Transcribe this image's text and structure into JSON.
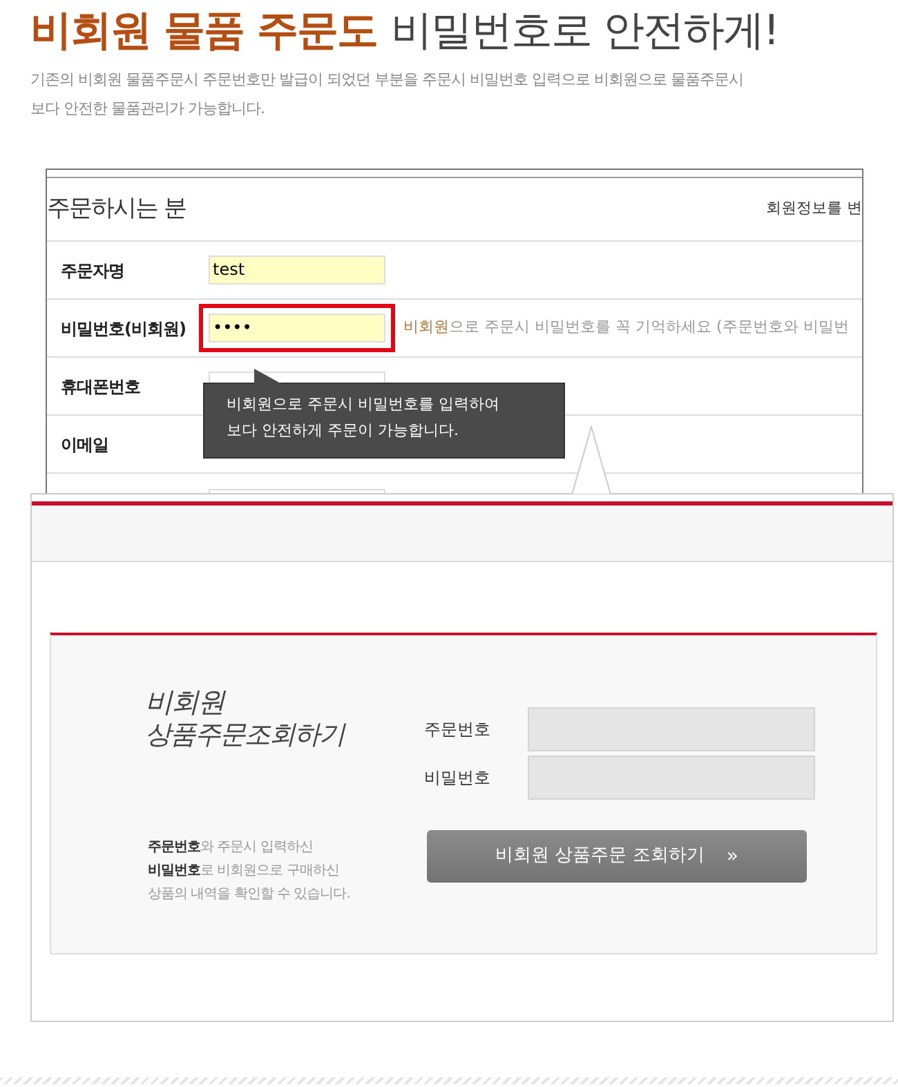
{
  "headline": {
    "accent": "비회원 물품 주문도",
    "rest": "비밀번호로 안전하게!"
  },
  "intro": [
    "기존의 비회원 물품주문시 주문번호만 발급이 되었던 부분을 주문시 비밀번호 입력으로 비회원으로 물품주문시",
    "보다 안전한 물품관리가 가능합니다."
  ],
  "order_form": {
    "title": "주문하시는 분",
    "top_link": "회원정보를 변",
    "rows": [
      {
        "label": "주문자명",
        "value": "test",
        "highlighted": false,
        "field_shown": true
      },
      {
        "label": "비밀번호(비회원)",
        "value": "••••",
        "highlighted": true,
        "field_shown": true,
        "hint_accent": "비회원",
        "hint": "으로 주문시 비밀번호를 꼭 기억하세요 (주문번호와 비밀번"
      },
      {
        "label": "휴대폰번호",
        "value": "",
        "highlighted": false,
        "field_shown": true
      },
      {
        "label": "이메일",
        "value": "",
        "highlighted": false
      }
    ]
  },
  "tooltip": [
    "비회원으로 주문시 비밀번호를 입력하여",
    "보다 안전하게 주문이 가능합니다."
  ],
  "lookup": {
    "title": [
      "비회원",
      "상품주문조회하기"
    ],
    "note": [
      "**주문번호**와 주문시 입력하신",
      "**비밀번호**로 비회원으로 구매하신",
      "상품의 내역을 확인할 수 있습니다."
    ],
    "fields": [
      {
        "label": "주문번호"
      },
      {
        "label": "비밀번호"
      }
    ],
    "button": "비회원 상품주문 조회하기",
    "button_icon": "»"
  }
}
